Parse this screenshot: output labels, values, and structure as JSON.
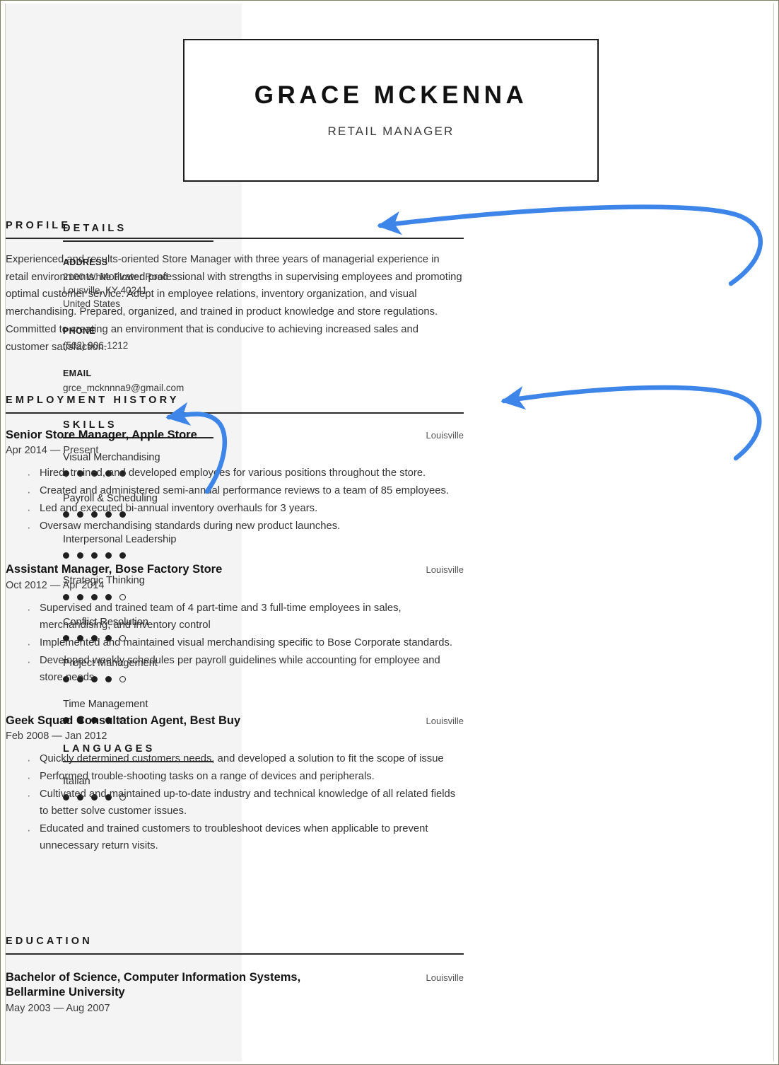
{
  "header": {
    "name": "GRACE MCKENNA",
    "title": "RETAIL MANAGER"
  },
  "sidebar": {
    "details": {
      "heading": "DETAILS",
      "address_label": "ADDRESS",
      "address_line1": "2100 White Flower Road",
      "address_line2": "Lousville, KY 40241",
      "address_line3": "United States",
      "phone_label": "PHONE",
      "phone": "(502) 906-1212",
      "email_label": "EMAIL",
      "email": "grce_mcknnna9@gmail.com"
    },
    "skills": {
      "heading": "SKILLS",
      "max_rating": 5,
      "items": [
        {
          "label": "Visual Merchandising",
          "rating": 5
        },
        {
          "label": "Payroll & Scheduling",
          "rating": 5
        },
        {
          "label": "Interpersonal Leadership",
          "rating": 5
        },
        {
          "label": "Strategic Thinking",
          "rating": 4
        },
        {
          "label": "Conflict Resolution",
          "rating": 4
        },
        {
          "label": "Project Management",
          "rating": 4
        },
        {
          "label": "Time Management",
          "rating": 4
        }
      ]
    },
    "languages": {
      "heading": "LANGUAGES",
      "max_rating": 5,
      "items": [
        {
          "label": "Italian",
          "rating": 4
        }
      ]
    }
  },
  "main": {
    "profile": {
      "heading": "PROFILE",
      "text": "Experienced and results-oriented Store Manager with three years of managerial experience in retail environments. Motivated professional with strengths in supervising employees and promoting optimal customer service. Adept in employee relations, inventory organization, and visual merchandising. Prepared, organized, and trained in product knowledge and store regulations. Committed to creating an environment that is conducive to achieving increased sales and customer satisfaction."
    },
    "employment": {
      "heading": "EMPLOYMENT HISTORY",
      "jobs": [
        {
          "title": "Senior Store Manager, Apple Store",
          "city": "Louisville",
          "dates": "Apr 2014 — Present",
          "bullets": [
            "Hired, trained, and developed employees for various positions throughout the store.",
            "Created and administered semi-annual performance reviews to a team of 85 employees.",
            "Led and executed bi-annual inventory overhauls for 3 years.",
            "Oversaw merchandising standards during new product launches."
          ]
        },
        {
          "title": "Assistant Manager, Bose Factory Store",
          "city": "Louisville",
          "dates": "Oct 2012 — Apr 2014",
          "bullets": [
            "Supervised and trained team of 4 part-time and 3 full-time employees in sales, merchandising, and inventory control",
            "Implemented and maintained visual merchandising specific to Bose Corporate standards.",
            "Developed weekly schedules per payroll guidelines while accounting for employee and store needs."
          ]
        },
        {
          "title": "Geek Squad Consultation Agent, Best Buy",
          "city": "Louisville",
          "dates": "Feb 2008 — Jan 2012",
          "bullets": [
            "Quickly determined customers needs, and developed a solution to fit the scope of issue",
            "Performed trouble-shooting tasks on a range of devices and peripherals.",
            "Cultivated and maintained up-to-date industry and technical knowledge of all related fields to better solve customer issues.",
            "Educated and trained customers to troubleshoot devices when applicable to prevent unnecessary return visits."
          ]
        }
      ]
    },
    "education": {
      "heading": "EDUCATION",
      "entries": [
        {
          "title": "Bachelor of Science, Computer Information Systems, Bellarmine University",
          "city": "Louisville",
          "dates": "May 2003 — Aug 2007"
        }
      ]
    }
  },
  "annotations": {
    "arrow_color": "#3d85e8",
    "arrows": [
      {
        "name": "arrow-to-profile",
        "target": "PROFILE"
      },
      {
        "name": "arrow-to-employment",
        "target": "EMPLOYMENT HISTORY"
      },
      {
        "name": "arrow-to-skills",
        "target": "SKILLS"
      }
    ]
  },
  "theme": {
    "sidebar_bg": "#f4f4f4",
    "page_bg": "#ffffff",
    "ink": "#1a1a1a"
  }
}
